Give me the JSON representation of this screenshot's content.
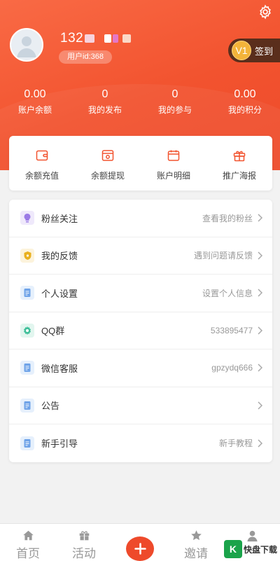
{
  "colors": {
    "accent": "#f2532f",
    "vip_gold": "#f3b33a",
    "signin_bg": "#5a2e1c"
  },
  "header": {
    "username_prefix": "132",
    "user_id": "用户id:368",
    "vip_level": "V1",
    "signin_label": "签到",
    "settings_icon": "gear-icon"
  },
  "stats": [
    {
      "value": "0.00",
      "label": "账户余额"
    },
    {
      "value": "0",
      "label": "我的发布"
    },
    {
      "value": "0",
      "label": "我的参与"
    },
    {
      "value": "0.00",
      "label": "我的积分"
    }
  ],
  "actions": [
    {
      "label": "余额充值",
      "icon": "wallet-icon"
    },
    {
      "label": "余额提现",
      "icon": "safe-box-icon"
    },
    {
      "label": "账户明细",
      "icon": "calendar-icon"
    },
    {
      "label": "推广海报",
      "icon": "gift-icon"
    }
  ],
  "menu": [
    {
      "title": "粉丝关注",
      "value": "查看我的粉丝",
      "icon": "bulb-icon",
      "icon_color": "#9b7be6",
      "icon_bg": "#efe9fb"
    },
    {
      "title": "我的反馈",
      "value": "遇到问题请反馈",
      "icon": "shield-icon",
      "icon_color": "#e9b020",
      "icon_bg": "#fcf3dc"
    },
    {
      "title": "个人设置",
      "value": "设置个人信息",
      "icon": "document-icon",
      "icon_color": "#6fa3e8",
      "icon_bg": "#e6f0fc"
    },
    {
      "title": "QQ群",
      "value": "533895477",
      "icon": "gear-icon",
      "icon_color": "#3fbf9a",
      "icon_bg": "#e2f6ef"
    },
    {
      "title": "微信客服",
      "value": "gpzydq666",
      "icon": "document-icon",
      "icon_color": "#6fa3e8",
      "icon_bg": "#e6f0fc"
    },
    {
      "title": "公告",
      "value": "",
      "icon": "document-icon",
      "icon_color": "#6fa3e8",
      "icon_bg": "#e6f0fc"
    },
    {
      "title": "新手引导",
      "value": "新手教程",
      "icon": "document-icon",
      "icon_color": "#6fa3e8",
      "icon_bg": "#e6f0fc"
    }
  ],
  "tabbar": [
    {
      "label": "首页",
      "icon": "home-icon"
    },
    {
      "label": "活动",
      "icon": "gift-icon"
    },
    {
      "label": "",
      "icon": "plus-icon"
    },
    {
      "label": "邀请",
      "icon": "star-icon"
    },
    {
      "label": "",
      "icon": "person-icon"
    }
  ],
  "watermark": {
    "mark": "K",
    "text": "快盘下载"
  }
}
